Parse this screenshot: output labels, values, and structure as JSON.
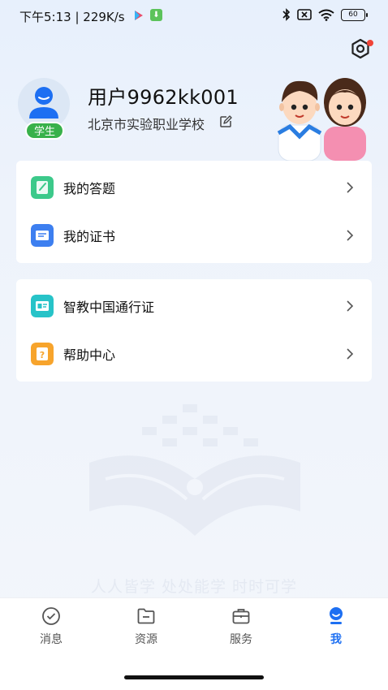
{
  "status_bar": {
    "time": "下午5:13",
    "speed": "229K/s",
    "battery": "60"
  },
  "profile": {
    "username": "用户9962kk001",
    "school": "北京市实验职业学校",
    "role_badge": "学生"
  },
  "menu_group_1": [
    {
      "label": "我的答题",
      "icon": "answer-icon",
      "color": "#3cc98a"
    },
    {
      "label": "我的证书",
      "icon": "certificate-icon",
      "color": "#3d7ff0"
    }
  ],
  "menu_group_2": [
    {
      "label": "智教中国通行证",
      "icon": "pass-icon",
      "color": "#27c3c8"
    },
    {
      "label": "帮助中心",
      "icon": "help-icon",
      "color": "#f7a42c"
    }
  ],
  "slogan": "人人皆学  处处能学  时时可学",
  "tabbar": [
    {
      "label": "消息",
      "icon": "message-icon",
      "active": false
    },
    {
      "label": "资源",
      "icon": "folder-icon",
      "active": false
    },
    {
      "label": "服务",
      "icon": "briefcase-icon",
      "active": false
    },
    {
      "label": "我",
      "icon": "person-icon",
      "active": true
    }
  ],
  "colors": {
    "accent": "#1d6ff2",
    "badge_green": "#38b14a",
    "notification_dot": "#f04438"
  }
}
